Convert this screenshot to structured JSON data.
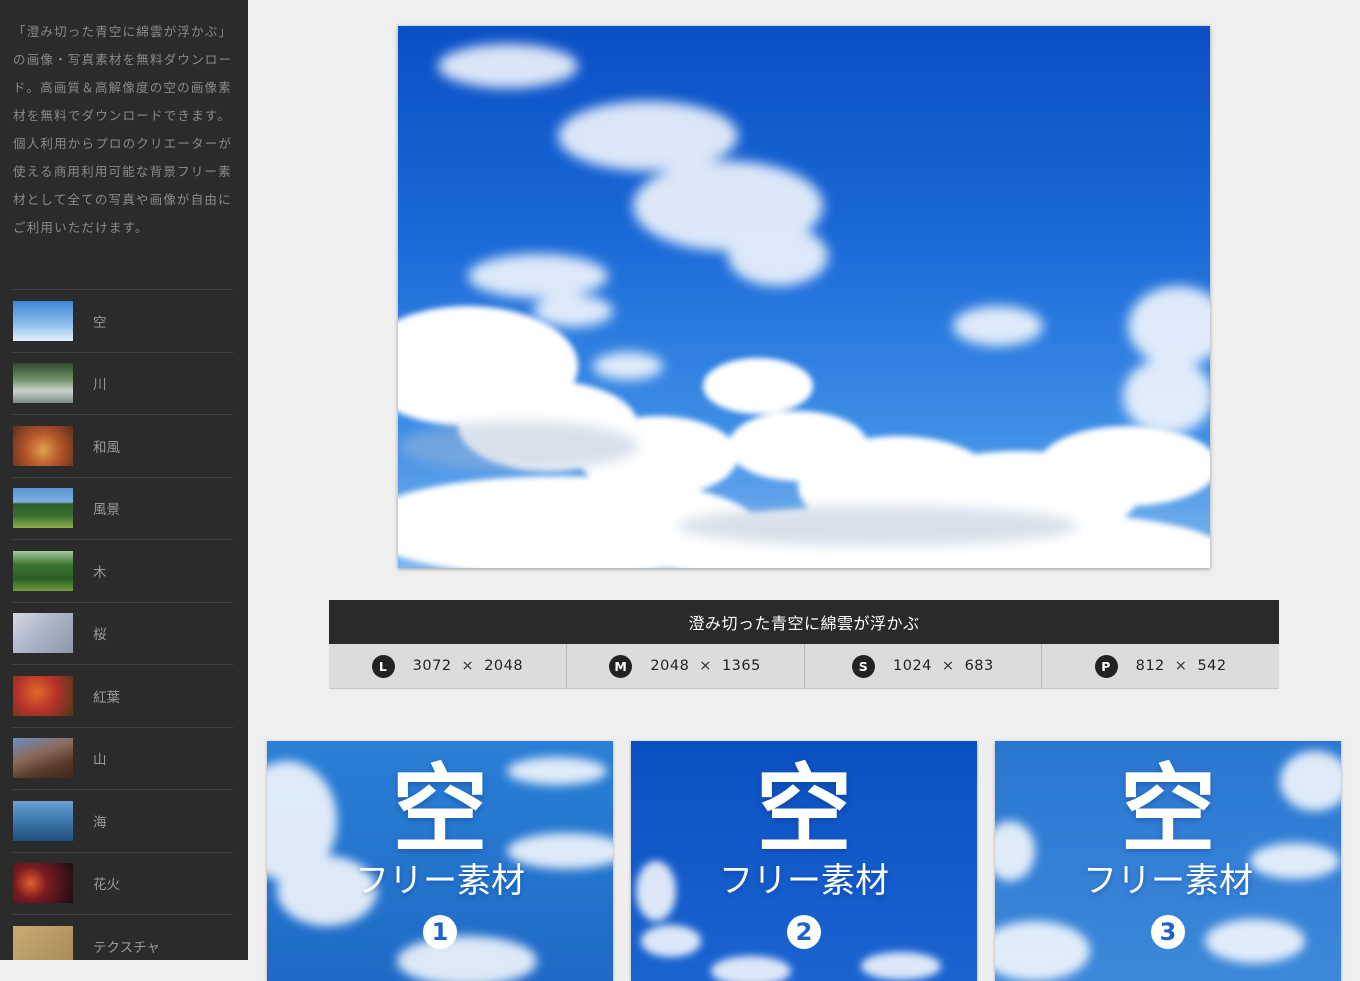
{
  "sidebar": {
    "description": "「澄み切った青空に綿雲が浮かぶ」の画像・写真素材を無料ダウンロード。高画質＆高解像度の空の画像素材を無料でダウンロードできます。個人利用からプロのクリエーターが使える商用利用可能な背景フリー素材として全ての写真や画像が自由にご利用いただけます。",
    "categories": [
      {
        "label": "空",
        "thumb": "#5f9bd8"
      },
      {
        "label": "川",
        "thumb": "#5c7a56"
      },
      {
        "label": "和風",
        "thumb": "#9a5a2c"
      },
      {
        "label": "風景",
        "thumb": "#4f7f42"
      },
      {
        "label": "木",
        "thumb": "#3f7a34"
      },
      {
        "label": "桜",
        "thumb": "#b7bcc9"
      },
      {
        "label": "紅葉",
        "thumb": "#b8452a"
      },
      {
        "label": "山",
        "thumb": "#6a4a3a"
      },
      {
        "label": "海",
        "thumb": "#3c6f9a"
      },
      {
        "label": "花火",
        "thumb": "#3a1a20"
      },
      {
        "label": "テクスチャ",
        "thumb": "#b79a66"
      }
    ]
  },
  "photo": {
    "title": "澄み切った青空に綿雲が浮かぶ",
    "sizes": [
      {
        "badge": "L",
        "width": "3072",
        "x": "×",
        "height": "2048"
      },
      {
        "badge": "M",
        "width": "2048",
        "x": "×",
        "height": "1365"
      },
      {
        "badge": "S",
        "width": "1024",
        "x": "×",
        "height": "683"
      },
      {
        "badge": "P",
        "width": "812",
        "x": "×",
        "height": "542"
      }
    ]
  },
  "cards": [
    {
      "title": "空",
      "subtitle": "フリー素材",
      "number": "1"
    },
    {
      "title": "空",
      "subtitle": "フリー素材",
      "number": "2"
    },
    {
      "title": "空",
      "subtitle": "フリー素材",
      "number": "3"
    }
  ]
}
